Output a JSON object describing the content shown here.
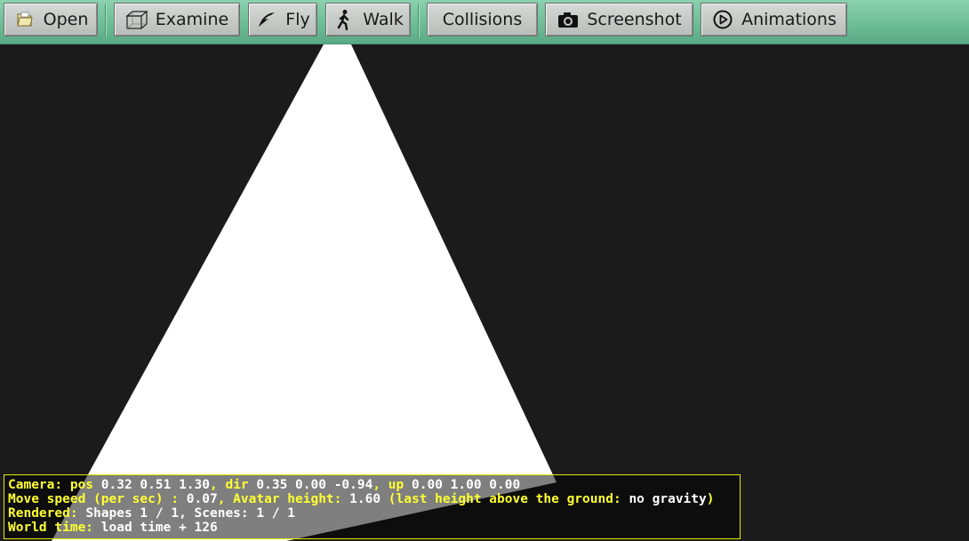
{
  "toolbar": {
    "buttons": [
      {
        "id": "open",
        "label": "Open",
        "icon": "folder-icon"
      },
      {
        "id": "examine",
        "label": "Examine",
        "icon": "cube-icon"
      },
      {
        "id": "fly",
        "label": "Fly",
        "icon": "bird-icon"
      },
      {
        "id": "walk",
        "label": "Walk",
        "icon": "walking-person-icon"
      },
      {
        "id": "collisions",
        "label": "Collisions"
      },
      {
        "id": "screenshot",
        "label": "Screenshot",
        "icon": "camera-icon"
      },
      {
        "id": "animations",
        "label": "Animations",
        "icon": "play-circle-icon"
      }
    ]
  },
  "status": {
    "camera_label": "Camera:",
    "pos_label": "pos",
    "pos_value": "0.32 0.51 1.30",
    "dir_label": ", dir",
    "dir_value": "0.35 0.00 -0.94",
    "up_label": ", up",
    "up_value": "0.00 1.00 0.00",
    "move_speed_label": "Move speed (per sec) :",
    "move_speed_value": "0.07",
    "avatar_height_label": ", Avatar height:",
    "avatar_height_value": "1.60",
    "last_height_label": "(last height above the ground:",
    "last_height_value": "no gravity",
    "close_paren": ")",
    "rendered_label": "Rendered:",
    "rendered_value": "Shapes 1 / 1, Scenes: 1 / 1",
    "world_time_label": "World time:",
    "world_time_value": "load time + 126"
  },
  "colors": {
    "toolbar": "#6dbd96",
    "background": "#1b1b1b",
    "shape": "#ffffff",
    "status_label": "#ffff33",
    "status_value": "#ffffff",
    "status_border": "#e8e800"
  }
}
